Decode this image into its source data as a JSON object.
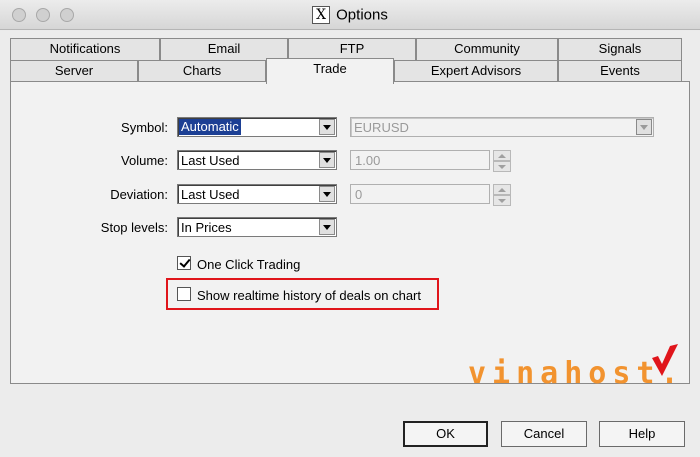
{
  "window": {
    "title": "Options"
  },
  "tabs_row1": [
    {
      "label": "Notifications"
    },
    {
      "label": "Email"
    },
    {
      "label": "FTP"
    },
    {
      "label": "Community"
    },
    {
      "label": "Signals"
    }
  ],
  "tabs_row2": [
    {
      "label": "Server"
    },
    {
      "label": "Charts"
    },
    {
      "label": "Trade",
      "active": true
    },
    {
      "label": "Expert Advisors"
    },
    {
      "label": "Events"
    }
  ],
  "trade": {
    "symbol_label": "Symbol:",
    "symbol_value": "Automatic",
    "symbol_right_value": "EURUSD",
    "volume_label": "Volume:",
    "volume_value": "Last Used",
    "volume_right_value": "1.00",
    "deviation_label": "Deviation:",
    "deviation_value": "Last Used",
    "deviation_right_value": "0",
    "stop_label": "Stop levels:",
    "stop_value": "In Prices",
    "one_click_label": "One Click Trading",
    "one_click_checked": true,
    "realtime_label": "Show realtime history of deals on chart",
    "realtime_checked": false
  },
  "watermark": {
    "text": "vinahost."
  },
  "buttons": {
    "ok": "OK",
    "cancel": "Cancel",
    "help": "Help"
  },
  "colors": {
    "highlight": "#e0151b",
    "selection": "#1c3f94",
    "watermark": "#f2932f"
  }
}
